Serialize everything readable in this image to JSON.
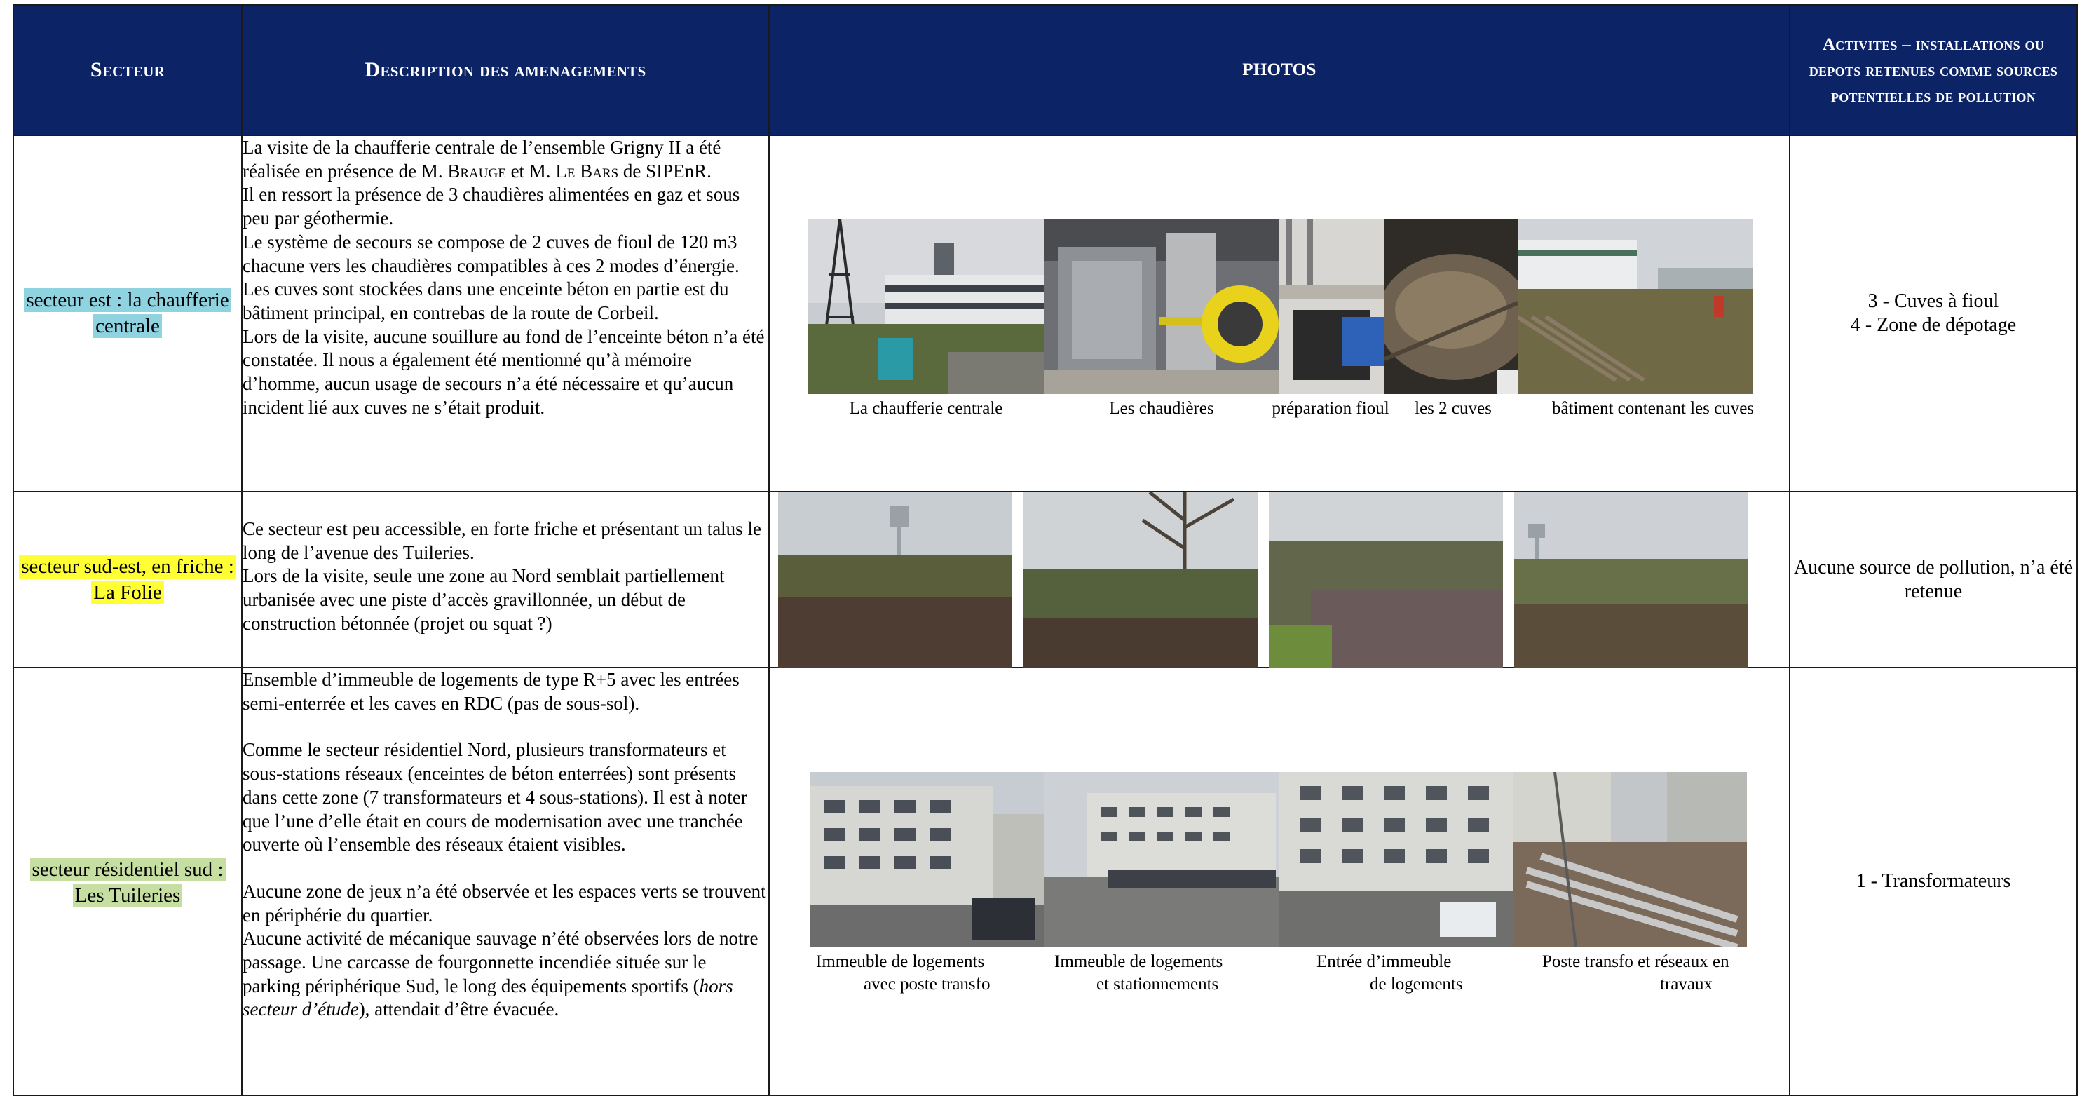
{
  "header": {
    "secteur": "Secteur",
    "description": "Description des amenagements",
    "photos": "PHOTOS",
    "activites": "Activites – installations ou depots retenues comme sources potentielles de pollution"
  },
  "rows": [
    {
      "sector": "secteur est : la chaufferie centrale",
      "description": [
        "La visite de la chaufferie centrale de l’ensemble Grigny II a été réalisée en présence de M. Brauge et M. Le Bars de SIPEnR.",
        "Il en ressort la présence de 3 chaudières alimentées en gaz et sous peu par géothermie.",
        "Le système de secours se compose de 2 cuves de fioul de 120 m3 chacune vers les chaudières compatibles à ces 2 modes d’énergie. Les cuves sont stockées dans une enceinte béton en partie est du bâtiment principal, en contrebas de la route de Corbeil.",
        "Lors de la visite, aucune souillure au fond de l’enceinte béton n’a été constatée. Il nous a également été mentionné qu’à mémoire d’homme, aucun usage de secours n’a été nécessaire et qu’aucun incident lié aux cuves ne s’était produit."
      ],
      "captions": [
        "La chaufferie centrale",
        "Les chaudières",
        "préparation fioul",
        "les 2 cuves",
        "bâtiment contenant les cuves"
      ],
      "activities": [
        "3 - Cuves à fioul",
        "4 - Zone de dépotage"
      ]
    },
    {
      "sector": "secteur sud-est, en friche : La Folie",
      "description": [
        "Ce secteur est peu accessible, en forte friche et présentant un talus le long de l’avenue des Tuileries.",
        "Lors de la visite, seule une zone au Nord semblait partiellement urbanisée avec une piste d’accès gravillonnée, un début de construction bétonnée (projet ou squat ?)"
      ],
      "activities": [
        "Aucune source de pollution, n’a été retenue"
      ]
    },
    {
      "sector": "secteur résidentiel sud : Les Tuileries",
      "description": [
        "Ensemble d’immeuble de logements de type R+5 avec les entrées semi-enterrée et les caves en RDC (pas de sous-sol).",
        "Comme le secteur résidentiel Nord, plusieurs transformateurs et sous-stations réseaux (enceintes de béton enterrées) sont présents dans cette zone (7 transformateurs et 4 sous-stations). Il est à noter que l’une d’elle était en cours de modernisation avec  une tranchée ouverte où l’ensemble des réseaux étaient visibles.",
        "Aucune zone de jeux n’a été observée et les espaces verts se trouvent en périphérie du quartier.",
        "Aucune activité de mécanique sauvage n’été observées lors de notre passage. Une carcasse de fourgonnette incendiée située sur le parking périphérique Sud, le long des équipements sportifs (",
        "hors secteur d’étude",
        "), attendait d’être évacuée."
      ],
      "captions": [
        [
          "Immeuble de logements",
          "avec poste transfo"
        ],
        [
          "Immeuble de logements",
          "et stationnements"
        ],
        [
          "Entrée d’immeuble",
          "de logements"
        ],
        [
          "Poste transfo et réseaux en",
          "travaux"
        ]
      ],
      "activities": [
        "1 - Transformateurs"
      ]
    }
  ]
}
